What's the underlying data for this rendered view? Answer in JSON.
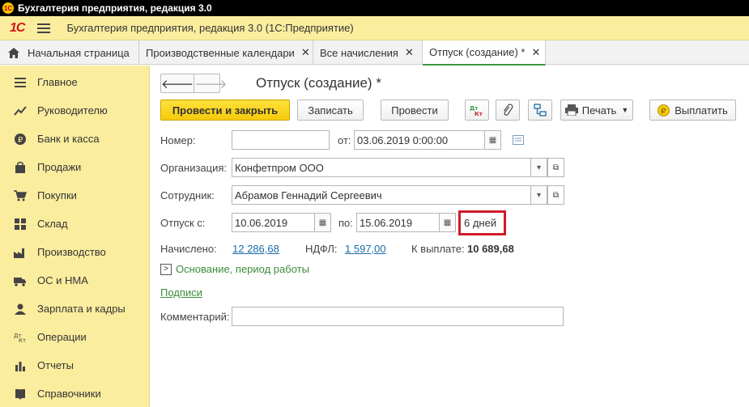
{
  "window": {
    "title": "Бухгалтерия предприятия, редакция 3.0"
  },
  "header": {
    "logo": "1С",
    "app_title": "Бухгалтерия предприятия, редакция 3.0  (1С:Предприятие)"
  },
  "tabs": [
    {
      "label": "Начальная страница"
    },
    {
      "label": "Производственные календари"
    },
    {
      "label": "Все начисления"
    },
    {
      "label": "Отпуск (создание) *"
    }
  ],
  "sidebar": {
    "items": [
      {
        "label": "Главное",
        "icon": "menu-lines-icon"
      },
      {
        "label": "Руководителю",
        "icon": "trend-chart-icon"
      },
      {
        "label": "Банк и касса",
        "icon": "ruble-coin-icon"
      },
      {
        "label": "Продажи",
        "icon": "shopping-bag-icon"
      },
      {
        "label": "Покупки",
        "icon": "cart-icon"
      },
      {
        "label": "Склад",
        "icon": "warehouse-grid-icon"
      },
      {
        "label": "Производство",
        "icon": "factory-icon"
      },
      {
        "label": "ОС и НМА",
        "icon": "truck-icon"
      },
      {
        "label": "Зарплата и кадры",
        "icon": "person-icon"
      },
      {
        "label": "Операции",
        "icon": "dt-kt-icon"
      },
      {
        "label": "Отчеты",
        "icon": "bar-chart-icon"
      },
      {
        "label": "Справочники",
        "icon": "book-icon"
      }
    ]
  },
  "document": {
    "title": "Отпуск (создание) *",
    "toolbar": {
      "post_close": "Провести и закрыть",
      "save": "Записать",
      "post": "Провести",
      "print": "Печать",
      "pay": "Выплатить",
      "dtkt_icon_text": "Дт Кт"
    },
    "number_label": "Номер:",
    "number_value": "",
    "date_label": "от:",
    "date_value": "03.06.2019  0:00:00",
    "org_label": "Организация:",
    "org_value": "Конфетпром ООО",
    "employee_label": "Сотрудник:",
    "employee_value": "Абрамов Геннадий Сергеевич",
    "vacation_label": "Отпуск с:",
    "vacation_from": "10.06.2019",
    "to_label": "по:",
    "vacation_to": "15.06.2019",
    "days": "6 дней",
    "accrued_label": "Начислено:",
    "accrued_value": "12 286,68",
    "ndfl_label": "НДФЛ:",
    "ndfl_value": "1 597,00",
    "topay_label": "К выплате:",
    "topay_value": "10 689,68",
    "basis_link": "Основание, период работы",
    "signatures_link": "Подписи",
    "comment_label": "Комментарий:",
    "comment_value": ""
  },
  "colors": {
    "header_bg": "#fbed9e",
    "primary_btn": "#f5cb0a",
    "highlight": "#d11b28",
    "link": "#1a6ca8",
    "active_tab": "#3c9a3c"
  }
}
